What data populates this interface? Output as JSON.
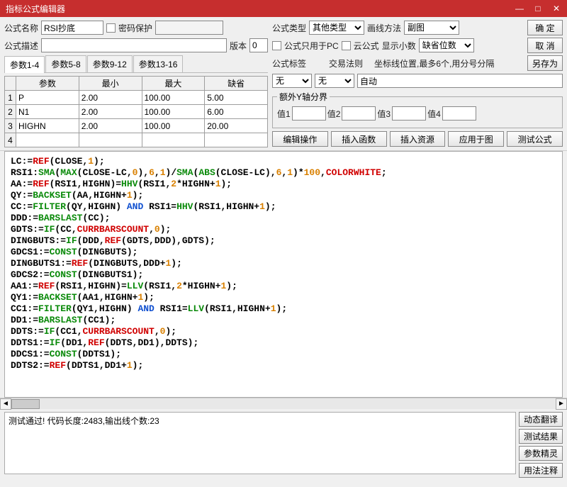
{
  "window": {
    "title": "指标公式编辑器"
  },
  "labels": {
    "name": "公式名称",
    "pwd": "密码保护",
    "type": "公式类型",
    "drawmode": "画线方法",
    "desc": "公式描述",
    "version": "版本",
    "pconly": "公式只用于PC",
    "cloud": "云公式",
    "decimals": "显示小数",
    "tag": "公式标签",
    "traderule": "交易法则",
    "axispos": "坐标线位置,最多6个,用分号分隔",
    "yextra": "额外Y轴分界",
    "v1": "值1",
    "v2": "值2",
    "v3": "值3",
    "v4": "值4"
  },
  "fields": {
    "name": "RSI抄底",
    "pwd": "",
    "typeSel": "其他类型",
    "drawSel": "副图",
    "desc": "",
    "version": "0",
    "decimalsSel": "缺省位数",
    "tagSel": "无",
    "tradeSel": "无",
    "axisAuto": "自动",
    "y1": "",
    "y2": "",
    "y3": "",
    "y4": ""
  },
  "buttons": {
    "ok": "确 定",
    "cancel": "取 消",
    "saveas": "另存为",
    "editop": "编辑操作",
    "insfunc": "插入函数",
    "insres": "插入资源",
    "apply": "应用于图",
    "test": "测试公式",
    "dynTrans": "动态翻译",
    "testRes": "测试结果",
    "paramWiz": "参数精灵",
    "usage": "用法注释"
  },
  "paramTabs": [
    "参数1-4",
    "参数5-8",
    "参数9-12",
    "参数13-16"
  ],
  "paramHead": [
    "参数",
    "最小",
    "最大",
    "缺省"
  ],
  "params": [
    {
      "n": "1",
      "name": "P",
      "min": "2.00",
      "max": "100.00",
      "def": "5.00"
    },
    {
      "n": "2",
      "name": "N1",
      "min": "2.00",
      "max": "100.00",
      "def": "6.00"
    },
    {
      "n": "3",
      "name": "HIGHN",
      "min": "2.00",
      "max": "100.00",
      "def": "20.00"
    },
    {
      "n": "4",
      "name": "",
      "min": "",
      "max": "",
      "def": ""
    }
  ],
  "status": "测试通过! 代码长度:2483,输出线个数:23",
  "code": [
    [
      [
        "",
        "LC:="
      ],
      [
        "r",
        "REF"
      ],
      [
        "",
        "(CLOSE,"
      ],
      [
        "o",
        "1"
      ],
      [
        "",
        "); "
      ]
    ],
    [
      [
        "",
        "RSI1:"
      ],
      [
        "g",
        "SMA"
      ],
      [
        "",
        "("
      ],
      [
        "g",
        "MAX"
      ],
      [
        "",
        "(CLOSE-LC,"
      ],
      [
        "o",
        "0"
      ],
      [
        "",
        "),"
      ],
      [
        "o",
        "6"
      ],
      [
        "",
        ","
      ],
      [
        "o",
        "1"
      ],
      [
        "",
        ")/"
      ],
      [
        "g",
        "SMA"
      ],
      [
        "",
        "("
      ],
      [
        "g",
        "ABS"
      ],
      [
        "",
        "(CLOSE-LC),"
      ],
      [
        "o",
        "6"
      ],
      [
        "",
        ","
      ],
      [
        "o",
        "1"
      ],
      [
        "",
        ")*"
      ],
      [
        "o",
        "100"
      ],
      [
        "",
        ","
      ],
      [
        "r",
        "COLORWHITE"
      ],
      [
        "",
        ";"
      ]
    ],
    [
      [
        "",
        "AA:="
      ],
      [
        "r",
        "REF"
      ],
      [
        "",
        "(RSI1,HIGHN)="
      ],
      [
        "g",
        "HHV"
      ],
      [
        "",
        "(RSI1,"
      ],
      [
        "o",
        "2"
      ],
      [
        "",
        "*HIGHN+"
      ],
      [
        "o",
        "1"
      ],
      [
        "",
        ");"
      ]
    ],
    [
      [
        "",
        "QY:="
      ],
      [
        "g",
        "BACKSET"
      ],
      [
        "",
        "(AA,HIGHN+"
      ],
      [
        "o",
        "1"
      ],
      [
        "",
        ");"
      ]
    ],
    [
      [
        "",
        "CC:="
      ],
      [
        "g",
        "FILTER"
      ],
      [
        "",
        "(QY,HIGHN) "
      ],
      [
        "b",
        "AND"
      ],
      [
        "",
        " RSI1="
      ],
      [
        "g",
        "HHV"
      ],
      [
        "",
        "(RSI1,HIGHN+"
      ],
      [
        "o",
        "1"
      ],
      [
        "",
        ");"
      ]
    ],
    [
      [
        "",
        "DDD:="
      ],
      [
        "g",
        "BARSLAST"
      ],
      [
        "",
        "(CC);"
      ]
    ],
    [
      [
        "",
        "GDTS:="
      ],
      [
        "g",
        "IF"
      ],
      [
        "",
        "(CC,"
      ],
      [
        "r",
        "CURRBARSCOUNT"
      ],
      [
        "",
        ","
      ],
      [
        "o",
        "0"
      ],
      [
        "",
        ");"
      ]
    ],
    [
      [
        "",
        "DINGBUTS:="
      ],
      [
        "g",
        "IF"
      ],
      [
        "",
        "(DDD,"
      ],
      [
        "r",
        "REF"
      ],
      [
        "",
        "(GDTS,DDD),GDTS);"
      ]
    ],
    [
      [
        "",
        "GDCS1:="
      ],
      [
        "g",
        "CONST"
      ],
      [
        "",
        "(DINGBUTS);"
      ]
    ],
    [
      [
        "",
        "DINGBUTS1:="
      ],
      [
        "r",
        "REF"
      ],
      [
        "",
        "(DINGBUTS,DDD+"
      ],
      [
        "o",
        "1"
      ],
      [
        "",
        ");"
      ]
    ],
    [
      [
        "",
        "GDCS2:="
      ],
      [
        "g",
        "CONST"
      ],
      [
        "",
        "(DINGBUTS1);"
      ]
    ],
    [
      [
        "",
        "AA1:="
      ],
      [
        "r",
        "REF"
      ],
      [
        "",
        "(RSI1,HIGHN)="
      ],
      [
        "g",
        "LLV"
      ],
      [
        "",
        "(RSI1,"
      ],
      [
        "o",
        "2"
      ],
      [
        "",
        "*HIGHN+"
      ],
      [
        "o",
        "1"
      ],
      [
        "",
        ");"
      ]
    ],
    [
      [
        "",
        "QY1:="
      ],
      [
        "g",
        "BACKSET"
      ],
      [
        "",
        "(AA1,HIGHN+"
      ],
      [
        "o",
        "1"
      ],
      [
        "",
        ");"
      ]
    ],
    [
      [
        "",
        "CC1:="
      ],
      [
        "g",
        "FILTER"
      ],
      [
        "",
        "(QY1,HIGHN) "
      ],
      [
        "b",
        "AND"
      ],
      [
        "",
        " RSI1="
      ],
      [
        "g",
        "LLV"
      ],
      [
        "",
        "(RSI1,HIGHN+"
      ],
      [
        "o",
        "1"
      ],
      [
        "",
        ");"
      ]
    ],
    [
      [
        "",
        "DD1:="
      ],
      [
        "g",
        "BARSLAST"
      ],
      [
        "",
        "(CC1);"
      ]
    ],
    [
      [
        "",
        "DDTS:="
      ],
      [
        "g",
        "IF"
      ],
      [
        "",
        "(CC1,"
      ],
      [
        "r",
        "CURRBARSCOUNT"
      ],
      [
        "",
        ","
      ],
      [
        "o",
        "0"
      ],
      [
        "",
        ");"
      ]
    ],
    [
      [
        "",
        "DDTS1:="
      ],
      [
        "g",
        "IF"
      ],
      [
        "",
        "(DD1,"
      ],
      [
        "r",
        "REF"
      ],
      [
        "",
        "(DDTS,DD1),DDTS);"
      ]
    ],
    [
      [
        "",
        "DDCS1:="
      ],
      [
        "g",
        "CONST"
      ],
      [
        "",
        "(DDTS1);"
      ]
    ],
    [
      [
        "",
        "DDTS2:="
      ],
      [
        "r",
        "REF"
      ],
      [
        "",
        "(DDTS1,DD1+"
      ],
      [
        "o",
        "1"
      ],
      [
        "",
        ");"
      ]
    ]
  ]
}
